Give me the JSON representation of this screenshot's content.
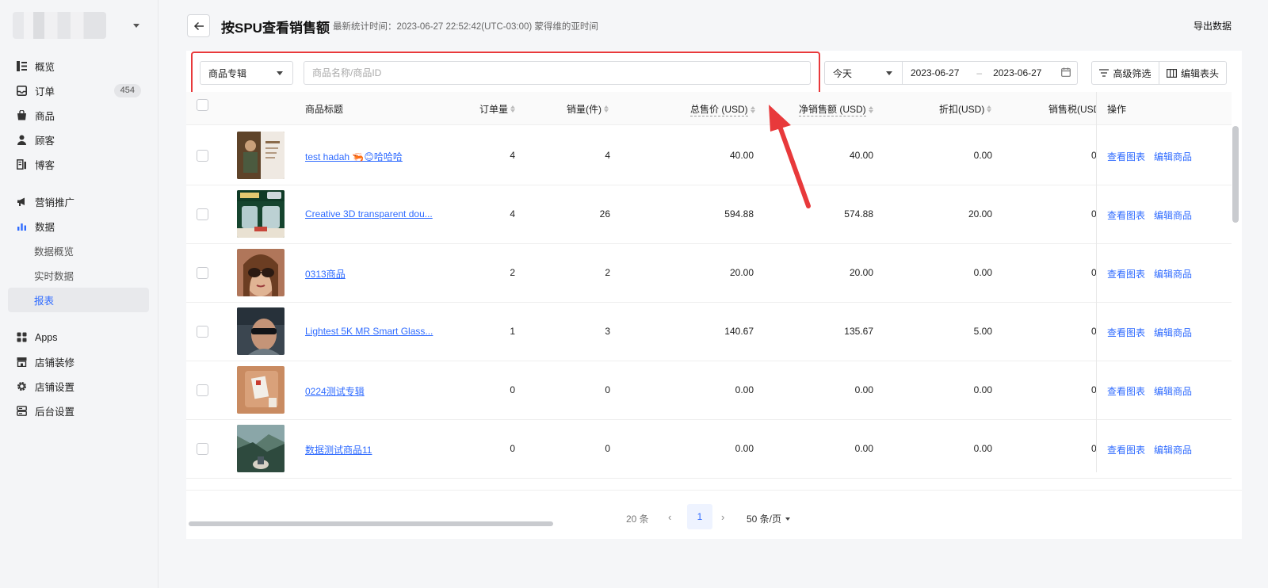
{
  "sidebar": {
    "items": [
      {
        "label": "概览",
        "icon": "overview-icon"
      },
      {
        "label": "订单",
        "icon": "order-icon",
        "badge": "454"
      },
      {
        "label": "商品",
        "icon": "product-bag-icon"
      },
      {
        "label": "顾客",
        "icon": "customer-person-icon"
      },
      {
        "label": "博客",
        "icon": "blog-icon"
      },
      {
        "label": "营销推广",
        "icon": "megaphone-icon"
      },
      {
        "label": "数据",
        "icon": "bar-chart-icon"
      },
      {
        "label": "数据概览"
      },
      {
        "label": "实时数据"
      },
      {
        "label": "报表"
      },
      {
        "label": "Apps",
        "icon": "apps-grid-icon"
      },
      {
        "label": "店铺装修",
        "icon": "storefront-icon"
      },
      {
        "label": "店铺设置",
        "icon": "gear-icon"
      },
      {
        "label": "后台设置",
        "icon": "server-settings-icon"
      }
    ]
  },
  "header": {
    "title": "按SPU查看销售额",
    "stat_time": "最新统计时间：2023-06-27 22:52:42(UTC-03:00) 蒙得维的亚时间",
    "export_label": "导出数据"
  },
  "filters": {
    "type_select": "商品专辑",
    "search_placeholder": "商品名称/商品ID",
    "day_select": "今天",
    "date_start": "2023-06-27",
    "date_sep": "–",
    "date_end": "2023-06-27",
    "advanced_label": "高级筛选",
    "edit_header_label": "编辑表头"
  },
  "table": {
    "headers": {
      "title": "商品标题",
      "orders": "订单量",
      "sales_qty": "销量(件)",
      "total_price": "总售价 (USD)",
      "net_sales": "净销售额 (USD)",
      "discount": "折扣(USD)",
      "tax": "销售税(USD",
      "ops": "操作"
    },
    "rows": [
      {
        "title": "test hadah 🦐😊哈哈哈",
        "orders": "4",
        "qty": "4",
        "total": "40.00",
        "net": "40.00",
        "discount": "0.00",
        "tax": "0",
        "view": "查看图表",
        "edit": "编辑商品"
      },
      {
        "title": "Creative 3D transparent dou...",
        "orders": "4",
        "qty": "26",
        "total": "594.88",
        "net": "574.88",
        "discount": "20.00",
        "tax": "0",
        "view": "查看图表",
        "edit": "编辑商品"
      },
      {
        "title": "0313商品",
        "orders": "2",
        "qty": "2",
        "total": "20.00",
        "net": "20.00",
        "discount": "0.00",
        "tax": "0",
        "view": "查看图表",
        "edit": "编辑商品"
      },
      {
        "title": "Lightest 5K MR Smart Glass...",
        "orders": "1",
        "qty": "3",
        "total": "140.67",
        "net": "135.67",
        "discount": "5.00",
        "tax": "0",
        "view": "查看图表",
        "edit": "编辑商品"
      },
      {
        "title": "0224测试专辑",
        "orders": "0",
        "qty": "0",
        "total": "0.00",
        "net": "0.00",
        "discount": "0.00",
        "tax": "0",
        "view": "查看图表",
        "edit": "编辑商品"
      },
      {
        "title": "数据测试商品11",
        "orders": "0",
        "qty": "0",
        "total": "0.00",
        "net": "0.00",
        "discount": "0.00",
        "tax": "0",
        "view": "查看图表",
        "edit": "编辑商品"
      }
    ]
  },
  "pagination": {
    "total": "20 条",
    "current": "1",
    "page_size": "50 条/页",
    "prev": "‹",
    "next": "›"
  },
  "colors": {
    "accent": "#2f6bff",
    "highlight": "#e8393b"
  }
}
